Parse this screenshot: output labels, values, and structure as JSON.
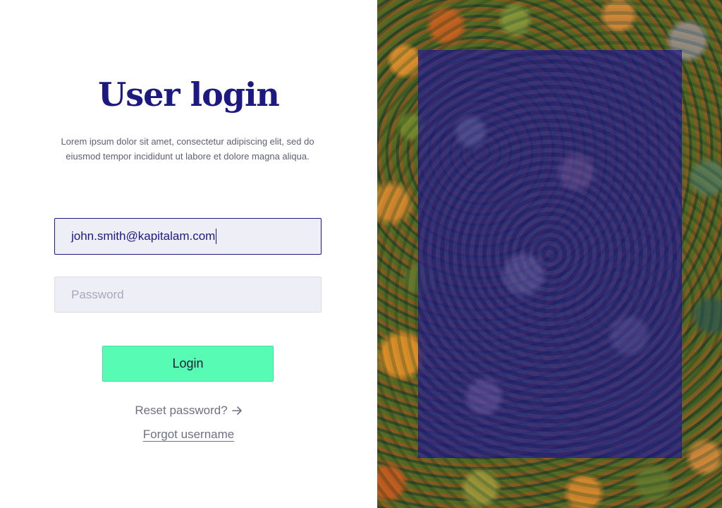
{
  "login": {
    "title": "User login",
    "subtitle": "Lorem ipsum dolor sit amet, consectetur adipiscing elit, sed do eiusmod tempor incididunt ut labore et dolore magna aliqua.",
    "email_value": "john.smith@kapitalam.com",
    "password_placeholder": "Password",
    "login_label": "Login",
    "reset_label": "Reset password?",
    "forgot_label": "Forgot username"
  },
  "icons": {
    "reset_arrow": "arrow-right-icon"
  },
  "colors": {
    "accent": "#1c1a80",
    "button": "#57fbb4",
    "overlay": "#1c1680"
  }
}
